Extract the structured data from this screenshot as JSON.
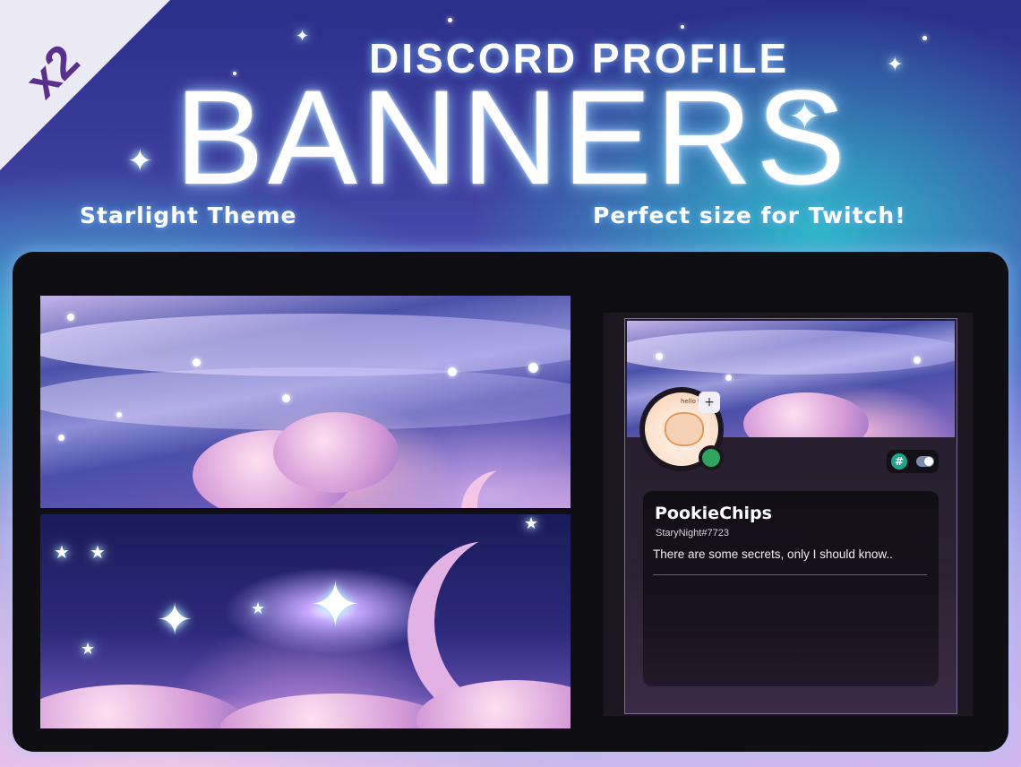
{
  "corner_badge": "x2",
  "header": {
    "subtitle": "DISCORD PROFILE",
    "title": "BANNERS",
    "tag_left": "Starlight Theme",
    "tag_right": "Perfect size for Twitch!"
  },
  "profile": {
    "username": "PookieChips",
    "usertag": "StaryNight#7723",
    "about": "There are some secrets, only I should know..",
    "avatar_caption": "hello there!",
    "status_color": "#2fa45a",
    "badges": [
      "hashtag-icon",
      "toggle-icon"
    ]
  },
  "colors": {
    "panel": "#0f0f13",
    "corner": "#ecebf5",
    "corner_text": "#5a2f8e"
  }
}
